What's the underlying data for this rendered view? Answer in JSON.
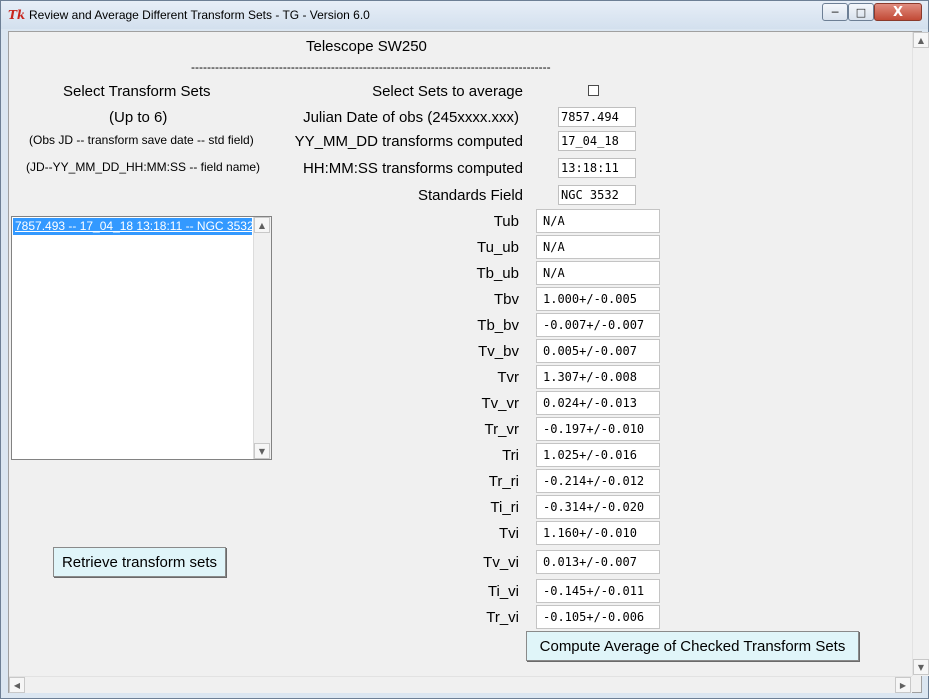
{
  "window": {
    "title": "Review and Average Different Transform Sets - TG  - Version 6.0",
    "minimize_glyph": "─",
    "maximize_glyph": "□",
    "close_glyph": "X"
  },
  "header": {
    "telescope": "Telescope SW250",
    "separator": "--------------------------------------------------------------------------------------------------------"
  },
  "left": {
    "select_sets_label": "Select Transform Sets",
    "up_to_label": "(Up to 6)",
    "format_hint_1": "(Obs JD -- transform save date -- std field)",
    "format_hint_2": "(JD--YY_MM_DD_HH:MM:SS -- field name)",
    "list_items": [
      "7857.493 -- 17_04_18 13:18:11 -- NGC 3532"
    ],
    "retrieve_button": "Retrieve transform sets"
  },
  "info": {
    "average_label": "Select Sets to average",
    "average_checked": false,
    "jd_label": "Julian Date of obs (245xxxx.xxx)",
    "jd_value": " 7857.494",
    "date_label": "YY_MM_DD transforms computed",
    "date_value": "17_04_18",
    "time_label": "HH:MM:SS transforms computed",
    "time_value": "13:18:11",
    "field_label": "Standards Field",
    "field_value": "NGC 3532"
  },
  "transforms": [
    {
      "name": "Tub",
      "value": "  N/A"
    },
    {
      "name": "Tu_ub",
      "value": "  N/A"
    },
    {
      "name": "Tb_ub",
      "value": "  N/A"
    },
    {
      "name": "Tbv",
      "value": " 1.000+/-0.005"
    },
    {
      "name": "Tb_bv",
      "value": "-0.007+/-0.007"
    },
    {
      "name": "Tv_bv",
      "value": " 0.005+/-0.007"
    },
    {
      "name": "Tvr",
      "value": " 1.307+/-0.008"
    },
    {
      "name": "Tv_vr",
      "value": " 0.024+/-0.013"
    },
    {
      "name": "Tr_vr",
      "value": "-0.197+/-0.010"
    },
    {
      "name": "Tri",
      "value": " 1.025+/-0.016"
    },
    {
      "name": "Tr_ri",
      "value": "-0.214+/-0.012"
    },
    {
      "name": "Ti_ri",
      "value": "-0.314+/-0.020"
    },
    {
      "name": "Tvi",
      "value": " 1.160+/-0.010"
    },
    {
      "name": "Tv_vi",
      "value": " 0.013+/-0.007"
    },
    {
      "name": "Ti_vi",
      "value": "-0.145+/-0.011"
    },
    {
      "name": "Tr_vi",
      "value": "-0.105+/-0.006"
    }
  ],
  "compute_button": "Compute Average of Checked Transform Sets",
  "scroll_icons": {
    "up": "▲",
    "down": "▼",
    "left": "◀",
    "right": "▶"
  }
}
